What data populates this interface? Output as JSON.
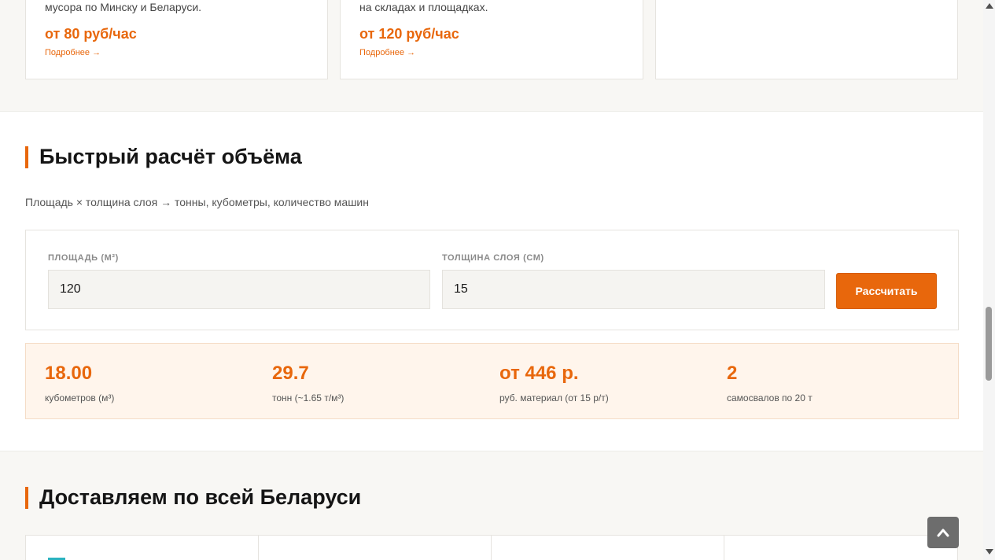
{
  "services": [
    {
      "desc": "мусора по Минску и Беларуси.",
      "price": "от 80 руб/час",
      "more": "Подробнее →"
    },
    {
      "desc": "на складах и площадках.",
      "price": "от 120 руб/час",
      "more": "Подробнее →"
    }
  ],
  "calc": {
    "title": "Быстрый расчёт объёма",
    "subtitle": "Площадь × толщина слоя → тонны, кубометры, количество машин",
    "area_label": "ПЛОЩАДЬ (М²)",
    "area_value": "120",
    "thickness_label": "ТОЛЩИНА СЛОЯ (СМ)",
    "thickness_value": "15",
    "button_label": "Рассчитать"
  },
  "results": [
    {
      "value": "18.00",
      "label": "кубометров (м³)"
    },
    {
      "value": "29.7",
      "label": "тонн (~1.65 т/м³)"
    },
    {
      "value": "от 446 р.",
      "label": "руб. материал (от 15 р/т)"
    },
    {
      "value": "2",
      "label": "самосвалов по 20 т"
    }
  ],
  "delivery": {
    "title": "Доставляем по всей Беларуси"
  },
  "colors": {
    "accent": "#e8670c",
    "result_bg": "#fff5ec",
    "band_bg": "#f8f7f4"
  },
  "icons": {
    "scroll_up": "chevron-up-icon",
    "scroll_down": "chevron-down-icon",
    "back_to_top": "chevron-up-icon"
  }
}
